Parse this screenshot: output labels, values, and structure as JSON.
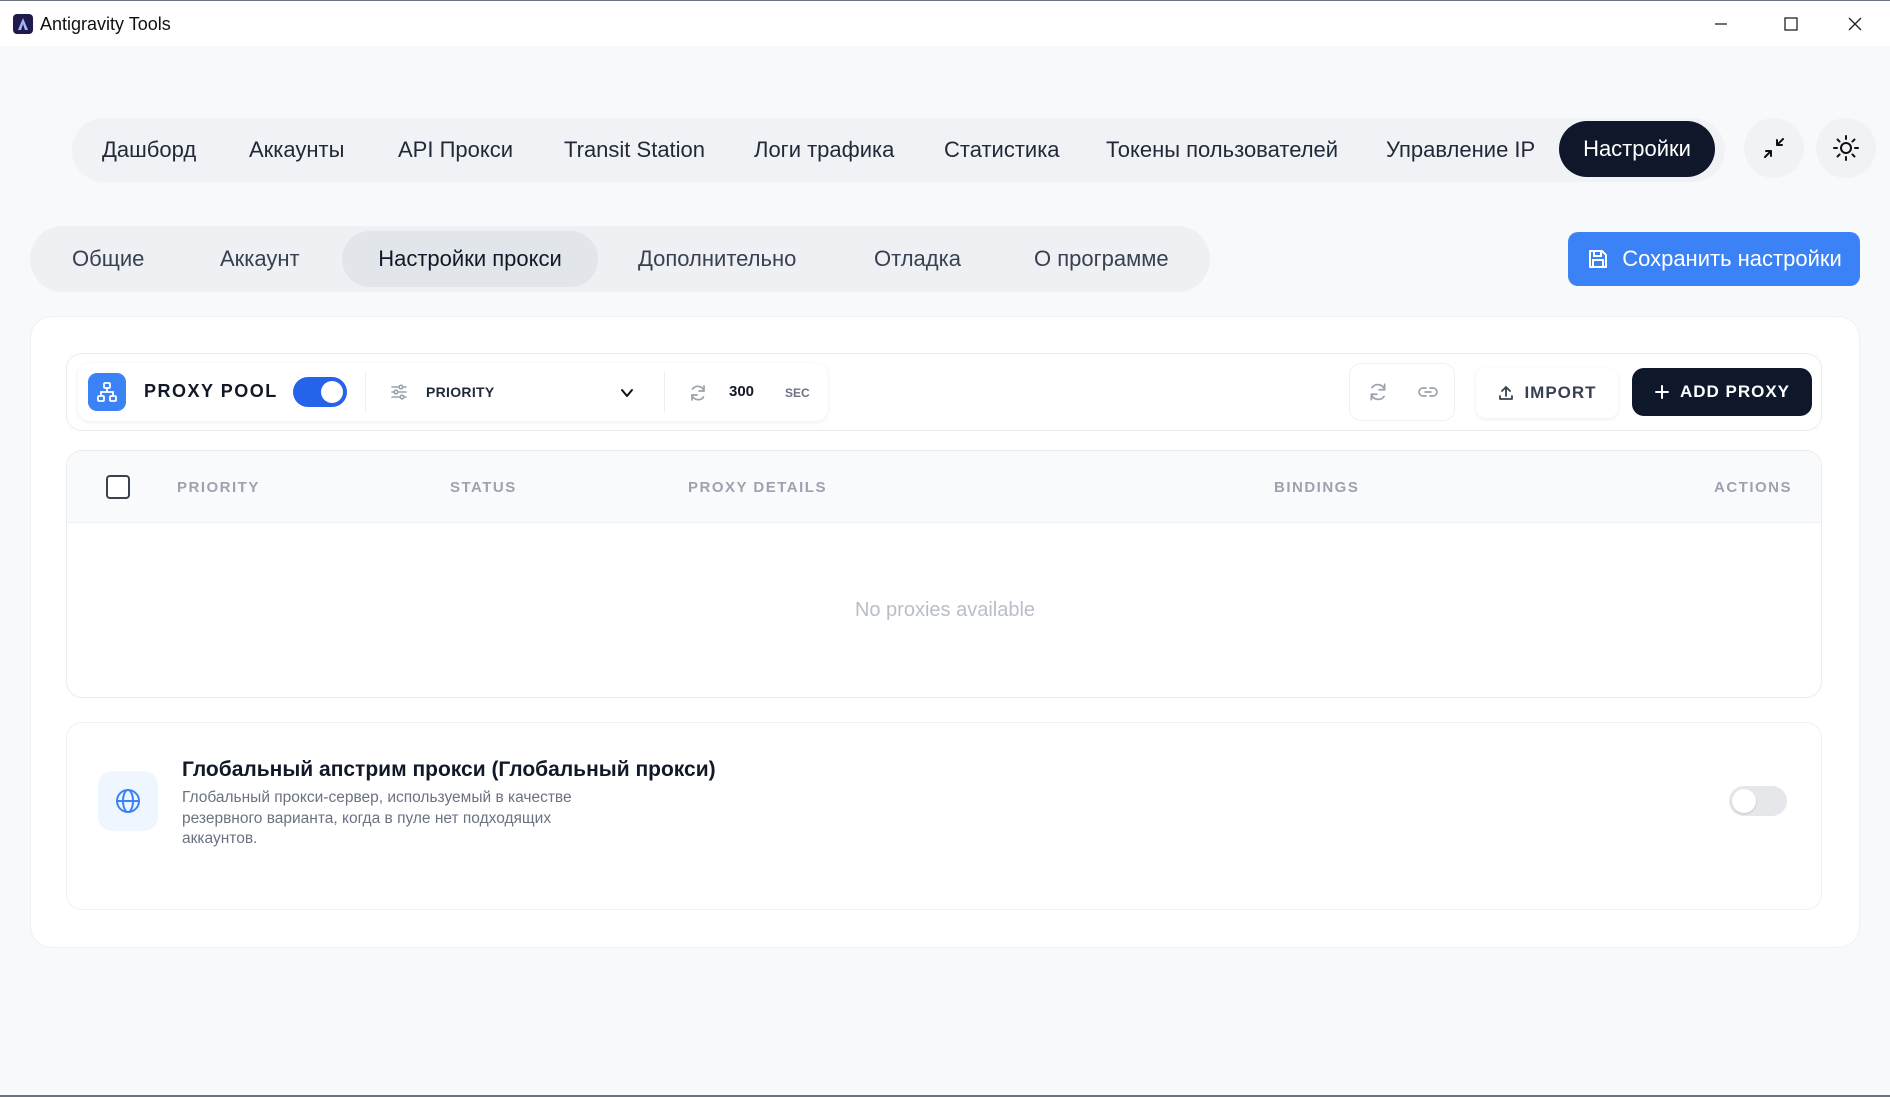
{
  "window": {
    "title": "Antigravity Tools",
    "controls": [
      "minimize-icon",
      "maximize-icon",
      "close-icon"
    ]
  },
  "topnav": {
    "items": [
      {
        "label": "Дашборд"
      },
      {
        "label": "Аккаунты"
      },
      {
        "label": "API Прокси"
      },
      {
        "label": "Transit Station"
      },
      {
        "label": "Логи трафика"
      },
      {
        "label": "Статистика"
      },
      {
        "label": "Токены пользователей"
      },
      {
        "label": "Управление IP"
      },
      {
        "label": "Настройки",
        "active": true
      }
    ],
    "active_label": "Настройки",
    "buttons": [
      "collapse-icon",
      "theme-sun-icon"
    ]
  },
  "subtabs": {
    "items": [
      {
        "label": "Общие"
      },
      {
        "label": "Аккаунт"
      },
      {
        "label": "Настройки прокси",
        "active": true
      },
      {
        "label": "Дополнительно"
      },
      {
        "label": "Отладка"
      },
      {
        "label": "О программе"
      }
    ],
    "active_label": "Настройки прокси"
  },
  "save_button": {
    "label": "Сохранить настройки",
    "icon": "save-icon"
  },
  "proxy_pool": {
    "label": "PROXY POOL",
    "enabled": true,
    "mode": "PRIORITY",
    "interval_value": "300",
    "interval_unit": "SEC",
    "import_label": "IMPORT",
    "add_label": "ADD PROXY"
  },
  "table": {
    "columns": [
      "PRIORITY",
      "STATUS",
      "PROXY DETAILS",
      "BINDINGS",
      "ACTIONS"
    ],
    "empty_text": "No proxies available",
    "rows": []
  },
  "global_proxy": {
    "title": "Глобальный апстрим прокси (Глобальный прокси)",
    "description": "Глобальный прокси-сервер, используемый в качестве резервного варианта, когда в пуле нет подходящих аккаунтов.",
    "enabled": false,
    "icon": "globe-icon"
  },
  "colors": {
    "accent": "#3b82f6",
    "dark": "#0f172a",
    "background": "#f8f9fb"
  }
}
